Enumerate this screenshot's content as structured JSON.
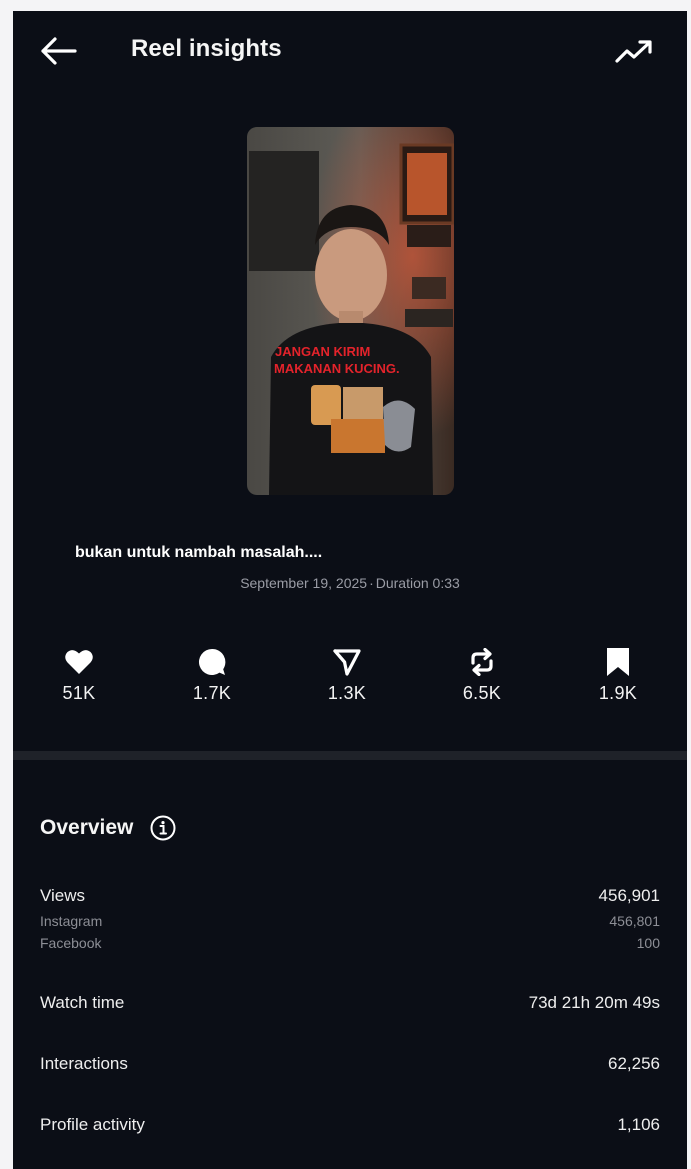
{
  "header": {
    "title": "Reel insights",
    "back_icon": "arrow-left-icon",
    "trend_icon": "trending-up-icon"
  },
  "reel": {
    "overlay_line1": "JANGAN KIRIM",
    "overlay_line2": "MAKANAN KUCING.",
    "caption": "bukan untuk nambah masalah....",
    "date": "September 19, 2025",
    "separator": "·",
    "duration": "Duration 0:33"
  },
  "stats": [
    {
      "icon": "heart-icon",
      "value": "51K"
    },
    {
      "icon": "comment-icon",
      "value": "1.7K"
    },
    {
      "icon": "send-icon",
      "value": "1.3K"
    },
    {
      "icon": "repost-icon",
      "value": "6.5K"
    },
    {
      "icon": "bookmark-icon",
      "value": "1.9K"
    }
  ],
  "overview": {
    "title": "Overview",
    "info_icon": "info-icon",
    "views_label": "Views",
    "views_value": "456,901",
    "instagram_label": "Instagram",
    "instagram_value": "456,801",
    "facebook_label": "Facebook",
    "facebook_value": "100",
    "watch_time_label": "Watch time",
    "watch_time_value": "73d 21h 20m 49s",
    "interactions_label": "Interactions",
    "interactions_value": "62,256",
    "profile_activity_label": "Profile activity",
    "profile_activity_value": "1,106"
  },
  "colors": {
    "background": "#0b0e16",
    "text": "#f5f5f5",
    "muted": "#8d8f96",
    "divider": "#1f2229",
    "overlay_text": "#e3232b"
  }
}
